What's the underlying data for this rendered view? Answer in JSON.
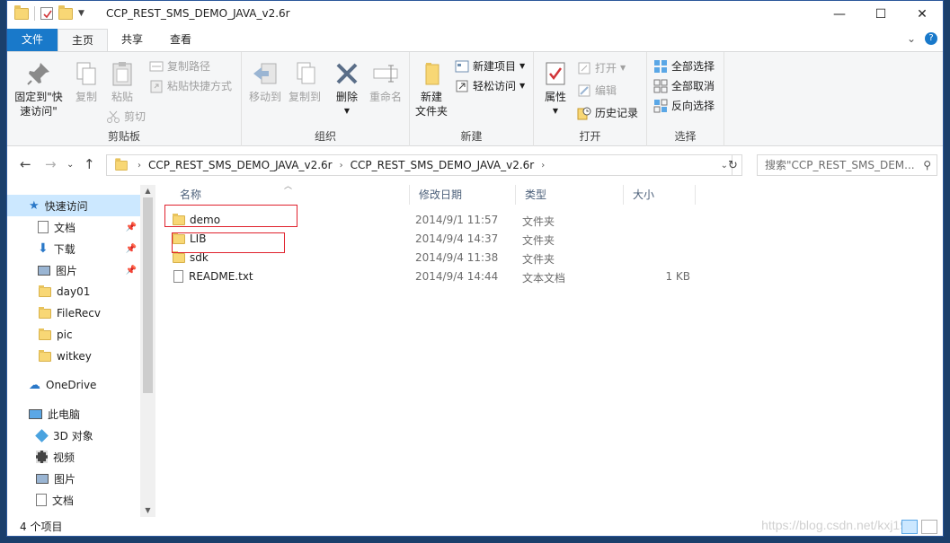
{
  "window": {
    "title": "CCP_REST_SMS_DEMO_JAVA_v2.6r",
    "controls": {
      "minimize": "—",
      "maximize": "☐",
      "close": "✕"
    }
  },
  "ribbon_tabs": [
    {
      "label": "文件"
    },
    {
      "label": "主页"
    },
    {
      "label": "共享"
    },
    {
      "label": "查看"
    }
  ],
  "ribbon": {
    "clipboard": {
      "label": "剪贴板",
      "pin_line1": "固定到\"快",
      "pin_line2": "速访问\"",
      "copy": "复制",
      "paste": "粘贴",
      "copy_path": "复制路径",
      "paste_shortcut": "粘贴快捷方式",
      "cut": "剪切"
    },
    "organize": {
      "label": "组织",
      "move_to": "移动到",
      "copy_to": "复制到",
      "delete": "删除",
      "rename": "重命名"
    },
    "new": {
      "label": "新建",
      "new_folder_line1": "新建",
      "new_folder_line2": "文件夹",
      "new_item": "新建项目",
      "easy_access": "轻松访问"
    },
    "open": {
      "label": "打开",
      "properties": "属性",
      "open": "打开",
      "edit": "编辑",
      "history": "历史记录"
    },
    "select": {
      "label": "选择",
      "select_all": "全部选择",
      "select_none": "全部取消",
      "invert": "反向选择"
    }
  },
  "address": {
    "crumbs": [
      "CCP_REST_SMS_DEMO_JAVA_v2.6r",
      "CCP_REST_SMS_DEMO_JAVA_v2.6r"
    ],
    "search_placeholder": "搜索\"CCP_REST_SMS_DEM..."
  },
  "nav": {
    "items": [
      {
        "label": "快速访问",
        "icon": "star-icon",
        "pinned": false
      },
      {
        "label": "文档",
        "icon": "document-icon",
        "pinned": true
      },
      {
        "label": "下载",
        "icon": "download-icon",
        "pinned": true
      },
      {
        "label": "图片",
        "icon": "picture-icon",
        "pinned": true
      },
      {
        "label": "day01",
        "icon": "folder-icon",
        "pinned": false
      },
      {
        "label": "FileRecv",
        "icon": "folder-icon",
        "pinned": false
      },
      {
        "label": "pic",
        "icon": "folder-icon",
        "pinned": false
      },
      {
        "label": "witkey",
        "icon": "folder-icon",
        "pinned": false
      },
      {
        "label": "OneDrive",
        "icon": "cloud-icon",
        "pinned": false
      },
      {
        "label": "此电脑",
        "icon": "computer-icon",
        "pinned": false
      },
      {
        "label": "3D 对象",
        "icon": "cube-icon",
        "pinned": false
      },
      {
        "label": "视频",
        "icon": "video-icon",
        "pinned": false
      },
      {
        "label": "图片",
        "icon": "picture-icon",
        "pinned": false
      },
      {
        "label": "文档",
        "icon": "document-icon",
        "pinned": false
      }
    ]
  },
  "columns": {
    "name": "名称",
    "date": "修改日期",
    "type": "类型",
    "size": "大小"
  },
  "files": [
    {
      "name": "demo",
      "date": "2014/9/1 11:57",
      "type": "文件夹",
      "size": "",
      "kind": "folder"
    },
    {
      "name": "LIB",
      "date": "2014/9/4 14:37",
      "type": "文件夹",
      "size": "",
      "kind": "folder"
    },
    {
      "name": "sdk",
      "date": "2014/9/4 11:38",
      "type": "文件夹",
      "size": "",
      "kind": "folder"
    },
    {
      "name": "README.txt",
      "date": "2014/9/4 14:44",
      "type": "文本文档",
      "size": "1 KB",
      "kind": "text"
    }
  ],
  "status": {
    "count": "4 个项目"
  },
  "watermark": "https://blog.csdn.net/kxj19"
}
